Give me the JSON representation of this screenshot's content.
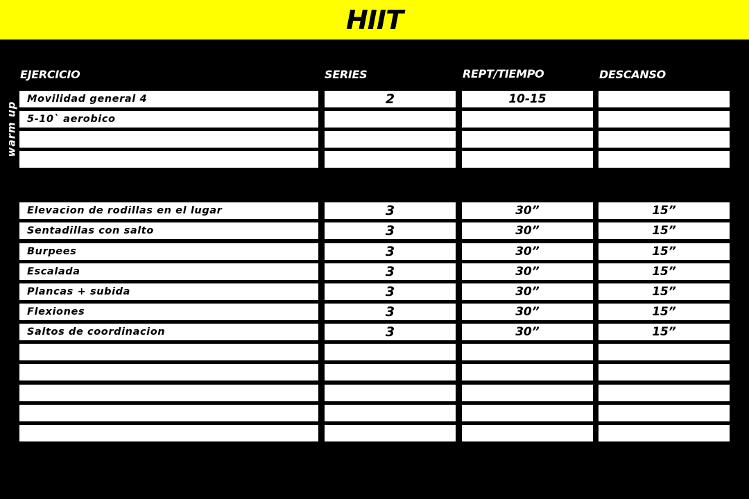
{
  "title": "HIIT",
  "columns": {
    "ejercicio": "EJERCICIO",
    "series": "SERIES",
    "repeticiones": "REPT/TIEMPO",
    "descanso": "DESCANSO"
  },
  "warmup": {
    "label": "warm up",
    "rows": [
      {
        "ejercicio": "Movilidad general 4",
        "series": "2",
        "reps": "10-15",
        "descanso": ""
      },
      {
        "ejercicio": "5-10` aerobico",
        "series": "",
        "reps": "",
        "descanso": ""
      },
      {
        "ejercicio": "",
        "series": "",
        "reps": "",
        "descanso": ""
      },
      {
        "ejercicio": "",
        "series": "",
        "reps": "",
        "descanso": ""
      }
    ]
  },
  "main": {
    "rows": [
      {
        "ejercicio": "Elevacion de rodillas en el lugar",
        "series": "3",
        "reps": "30”",
        "descanso": "15”"
      },
      {
        "ejercicio": "Sentadillas con salto",
        "series": "3",
        "reps": "30”",
        "descanso": "15”"
      },
      {
        "ejercicio": "Burpees",
        "series": "3",
        "reps": "30”",
        "descanso": "15”"
      },
      {
        "ejercicio": "Escalada",
        "series": "3",
        "reps": "30”",
        "descanso": "15”"
      },
      {
        "ejercicio": "Plancas + subida",
        "series": "3",
        "reps": "30”",
        "descanso": "15”"
      },
      {
        "ejercicio": "Flexiones",
        "series": "3",
        "reps": "30”",
        "descanso": "15”"
      },
      {
        "ejercicio": "Saltos de coordinacion",
        "series": "3",
        "reps": "30”",
        "descanso": "15”"
      },
      {
        "ejercicio": "",
        "series": "",
        "reps": "",
        "descanso": ""
      },
      {
        "ejercicio": "",
        "series": "",
        "reps": "",
        "descanso": ""
      },
      {
        "ejercicio": "",
        "series": "",
        "reps": "",
        "descanso": ""
      },
      {
        "ejercicio": "",
        "series": "",
        "reps": "",
        "descanso": ""
      },
      {
        "ejercicio": "",
        "series": "",
        "reps": "",
        "descanso": ""
      }
    ]
  },
  "colors": {
    "banner": "#ffff00",
    "background": "#000000",
    "cell": "#ffffff",
    "text": "#000000"
  }
}
